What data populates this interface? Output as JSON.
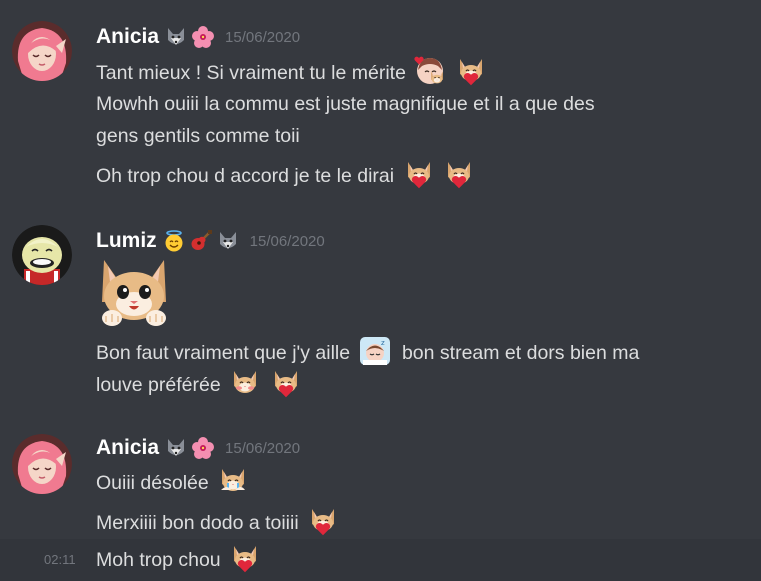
{
  "messages": {
    "group1": {
      "username": "Anicia",
      "badges": [
        "wolf-icon",
        "hibiscus-icon"
      ],
      "timestamp": "15/06/2020",
      "lines": [
        {
          "text": "Tant mieux ! Si vraiment tu le mérite",
          "emotes": [
            "heart-cat-emote",
            "love-cat-emote"
          ]
        },
        {
          "text": "Mowhh ouiii la commu est juste magnifique et il a que des",
          "emotes": []
        },
        {
          "text": "gens gentils comme toii",
          "emotes": []
        },
        {
          "text": "Oh trop chou d accord je te le dirai",
          "emotes": [
            "love-cat-emote",
            "love-cat-emote"
          ]
        }
      ]
    },
    "group2": {
      "username": "Lumiz",
      "badges": [
        "angel-smiley-icon",
        "guitar-icon",
        "wolf-icon"
      ],
      "timestamp": "15/06/2020",
      "big_emote": "happy-cat-emote",
      "lines": [
        {
          "text": "Bon faut vraiment que j'y aille",
          "emotes": [
            "sleepy-emote"
          ]
        },
        {
          "text": "bon stream et dors bien ma",
          "emotes": []
        },
        {
          "text": "louve préférée",
          "emotes": [
            "blush-cat-emote",
            "love-cat-emote"
          ]
        }
      ]
    },
    "group3": {
      "username": "Anicia",
      "badges": [
        "wolf-icon",
        "hibiscus-icon"
      ],
      "timestamp": "15/06/2020",
      "lines": [
        {
          "text": "Ouiii désolée",
          "emotes": [
            "crying-cat-emote"
          ]
        },
        {
          "text": "Merxiiii bon dodo a toiiii",
          "emotes": [
            "love-cat-emote"
          ]
        }
      ]
    },
    "hover_line": {
      "time": "02:11",
      "text": "Moh trop chou",
      "emotes": [
        "love-cat-emote"
      ]
    }
  },
  "colors": {
    "background": "#36393f",
    "hover_background": "#32353b",
    "username": "#ffffff",
    "text": "#dcddde",
    "timestamp": "#72767d"
  }
}
